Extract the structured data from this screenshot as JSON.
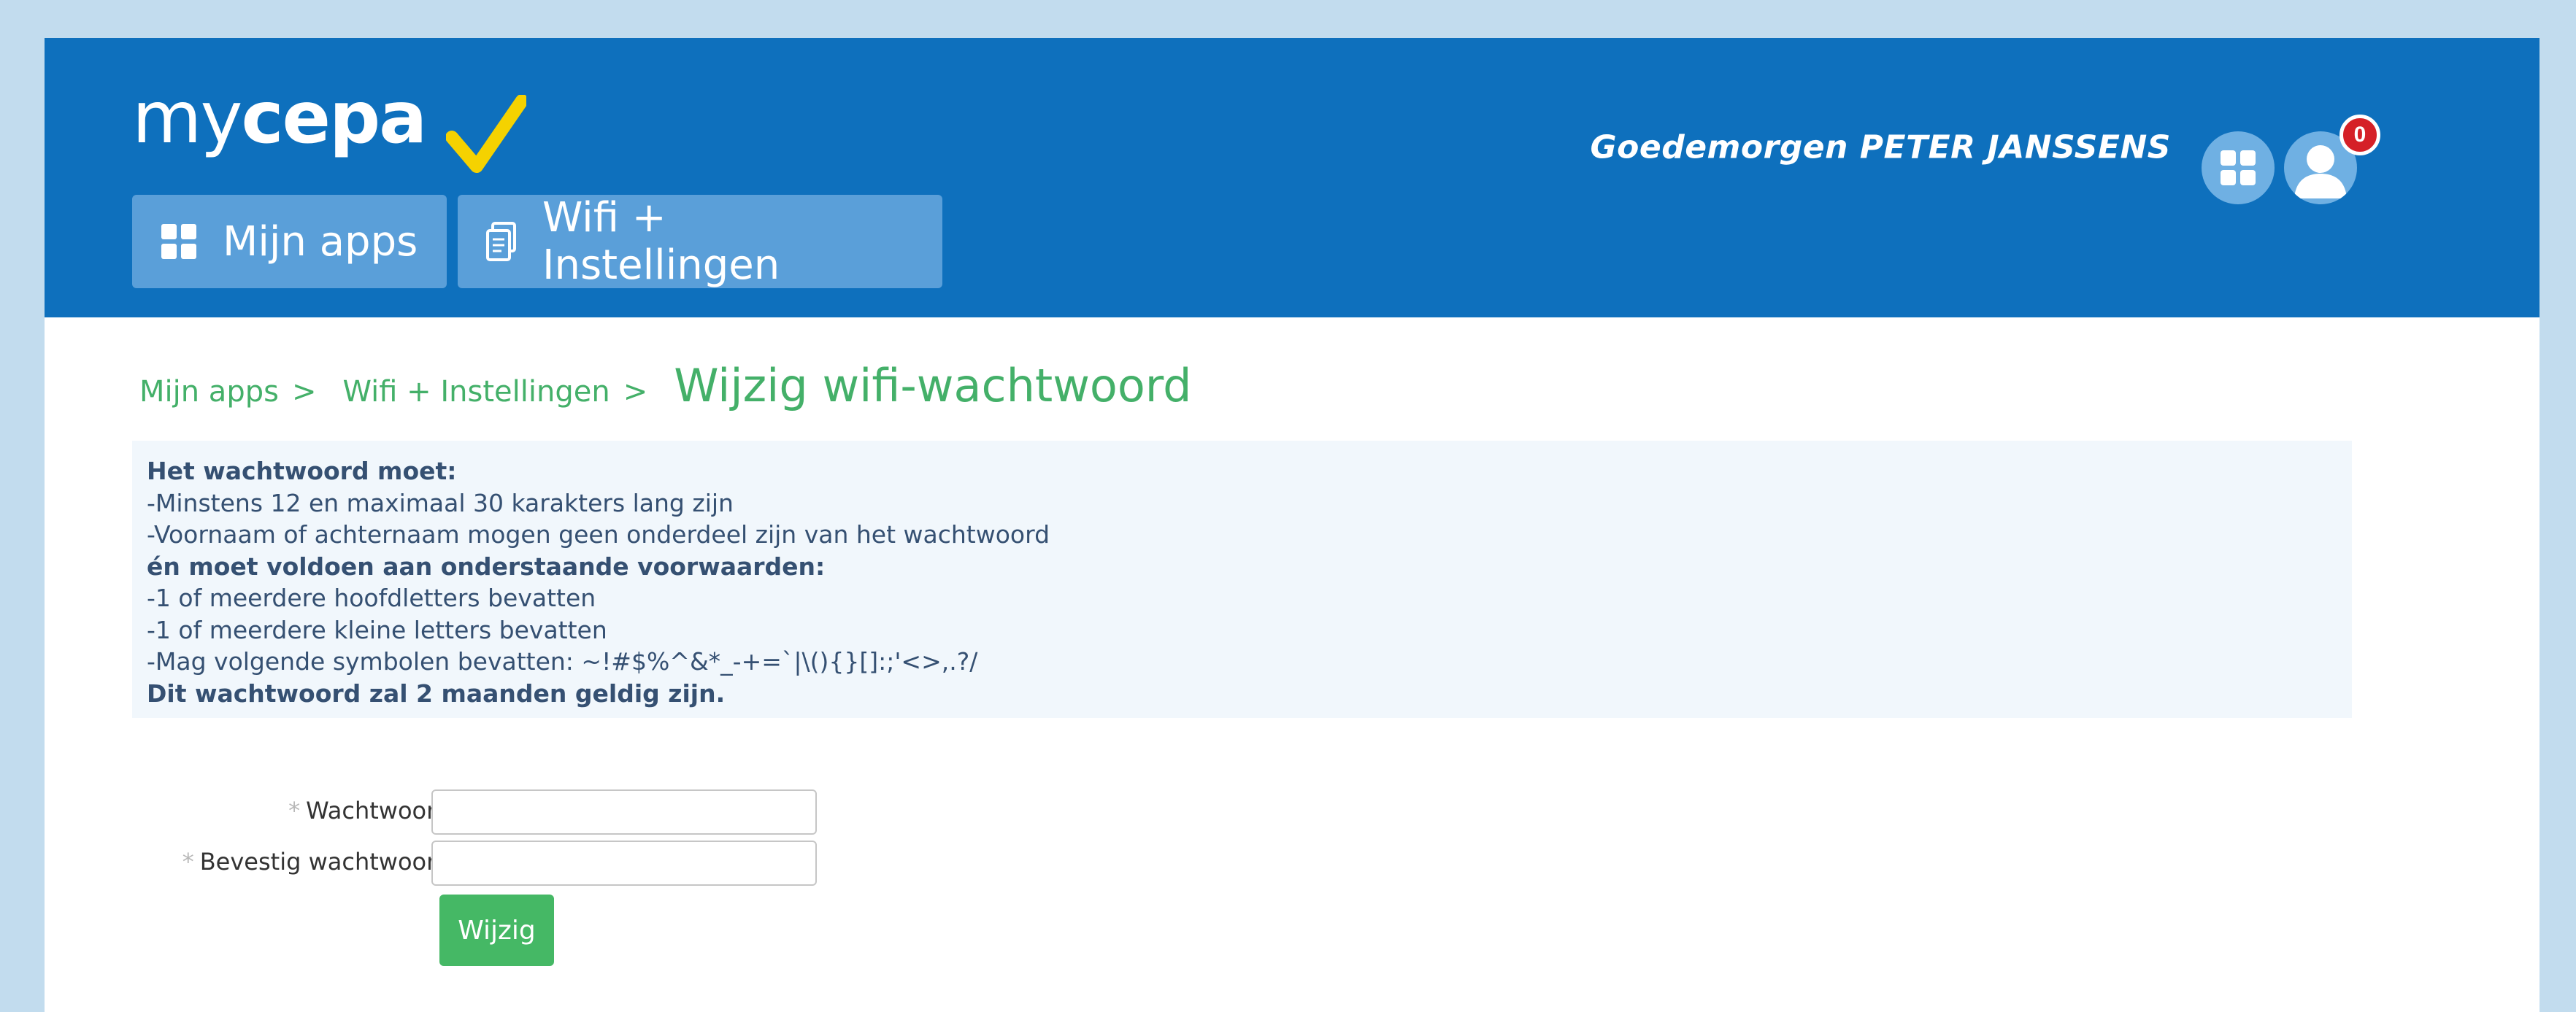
{
  "logo": {
    "part1": "my",
    "part2": "cepa"
  },
  "nav": {
    "apps_label": "Mijn apps",
    "wifi_label": "Wifi + Instellingen"
  },
  "header": {
    "greeting": "Goedemorgen PETER JANSSENS",
    "notification_count": "0",
    "icons": [
      "apps-grid-icon",
      "user-avatar-icon"
    ]
  },
  "breadcrumb": {
    "items": [
      "Mijn apps",
      "Wifi + Instellingen"
    ],
    "separator": ">",
    "current": "Wijzig wifi-wachtwoord"
  },
  "info": {
    "lines": [
      "Het wachtwoord moet:",
      "-Minstens 12 en maximaal 30 karakters lang zijn",
      "-Voornaam of achternaam mogen geen onderdeel zijn van het wachtwoord",
      "én moet voldoen aan onderstaande voorwaarden:",
      "-1 of meerdere hoofdletters bevatten",
      "-1 of meerdere kleine letters bevatten",
      "-Mag volgende symbolen bevatten: ~!#$%^&*_-+=`|\\(){}[]:;'<>,.?/",
      "Dit wachtwoord zal 2 maanden geldig zijn."
    ]
  },
  "form": {
    "required_mark": "*",
    "password_label": "Wachtwoord",
    "confirm_label": "Bevestig wachtwoord",
    "password_value": "",
    "confirm_value": "",
    "submit_label": "Wijzig"
  },
  "colors": {
    "header_bg": "#0e70bd",
    "page_bg": "#c2dcee",
    "accent_green": "#44b069",
    "check_yellow": "#f5d200",
    "badge_red": "#d52027"
  }
}
